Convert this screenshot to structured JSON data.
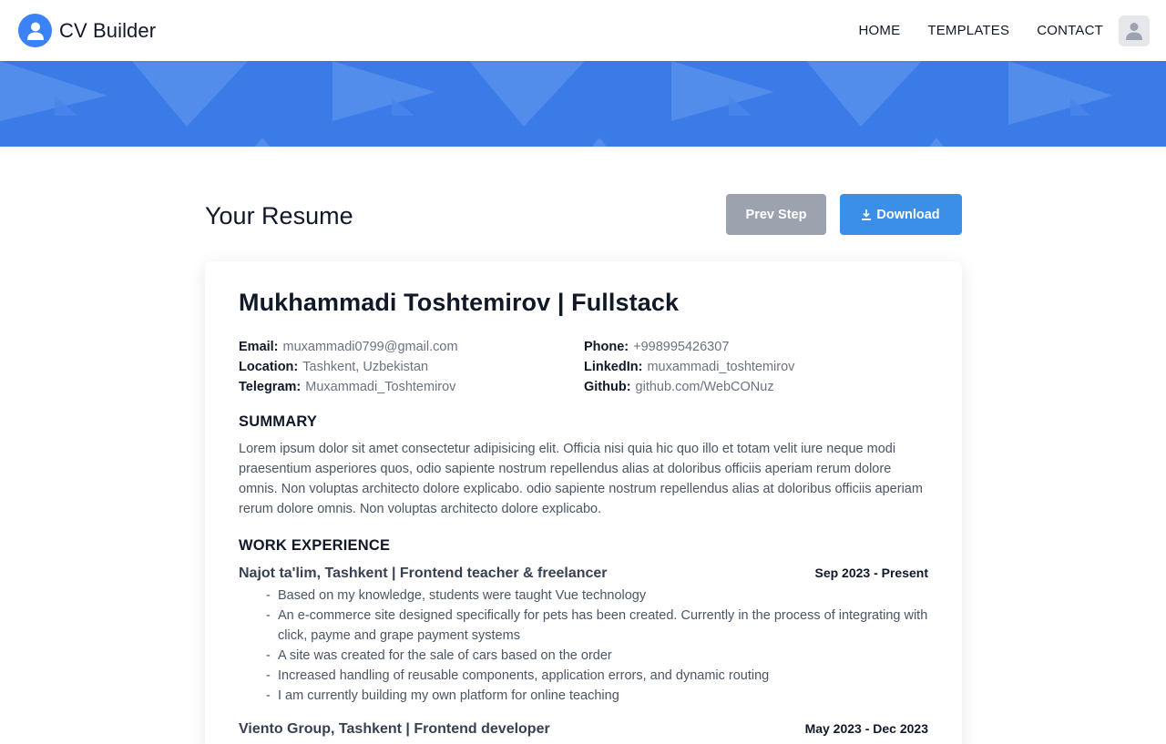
{
  "colors": {
    "primary": "#3b82f6",
    "banner": "#3a7be8",
    "prev_button": "#9ca3af",
    "download_button": "#3b8fe6"
  },
  "nav": {
    "brand": "CV Builder",
    "brand_icon": "user-circle-icon",
    "links": [
      "HOME",
      "TEMPLATES",
      "CONTACT"
    ],
    "avatar_icon": "user-avatar-icon"
  },
  "page": {
    "title": "Your Resume",
    "prev_label": "Prev Step",
    "download_label": "Download",
    "download_icon": "download-icon"
  },
  "resume": {
    "name": "Mukhammadi Toshtemirov | Fullstack",
    "contacts": {
      "email": {
        "label": "Email:",
        "value": "muxammadi0799@gmail.com"
      },
      "phone": {
        "label": "Phone:",
        "value": "+998995426307"
      },
      "location": {
        "label": "Location:",
        "value": "Tashkent, Uzbekistan"
      },
      "linkedin": {
        "label": "LinkedIn:",
        "value": "muxammadi_toshtemirov"
      },
      "telegram": {
        "label": "Telegram:",
        "value": "Muxammadi_Toshtemirov"
      },
      "github": {
        "label": "Github:",
        "value": "github.com/WebCONuz"
      }
    },
    "summary_title": "SUMMARY",
    "summary": "Lorem ipsum dolor sit amet consectetur adipisicing elit. Officia nisi quia hic quo illo et totam velit iure neque modi praesentium asperiores quos, odio sapiente nostrum repellendus alias at doloribus officiis aperiam rerum dolore omnis. Non voluptas architecto dolore explicabo. odio sapiente nostrum repellendus alias at doloribus officiis aperiam rerum dolore omnis. Non voluptas architecto dolore explicabo.",
    "work_title": "WORK EXPERIENCE",
    "jobs": [
      {
        "title": "Najot ta'lim, Tashkent | Frontend teacher & freelancer",
        "dates": "Sep 2023 - Present",
        "bullets": [
          "Based on my knowledge, students were taught Vue technology",
          "An e-commerce site designed specifically for pets has been created. Currently in the process of integrating with click, payme and grape payment systems",
          "A site was created for the sale of cars based on the order",
          "Increased handling of reusable components, application errors, and dynamic routing",
          "I am currently building my own platform for online teaching"
        ]
      },
      {
        "title": "Viento Group, Tashkent | Frontend developer",
        "dates": "May 2023 - Dec 2023"
      }
    ]
  }
}
